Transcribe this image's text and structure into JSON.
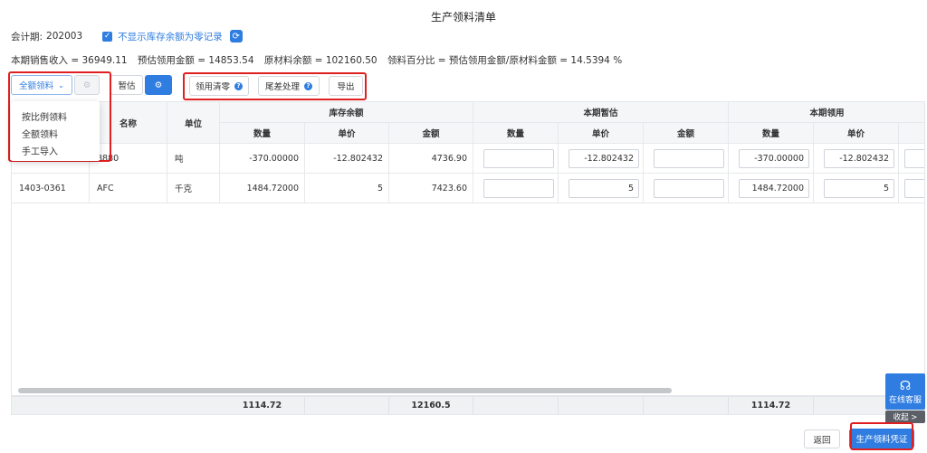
{
  "title": "生产领料清单",
  "period": {
    "label": "会计期:",
    "value": "202003"
  },
  "checkbox": {
    "label": "不显示库存余额为零记录",
    "checked": true
  },
  "summary": {
    "sales": "本期销售收入 = 36949.11",
    "estimate": "预估领用金额 = 14853.54",
    "material": "原材料余额 = 102160.50",
    "ratio": "领料百分比 = 预估领用金额/原材料金额 = 14.5394 %"
  },
  "toolbar": {
    "mode_select": "全额领料",
    "temp_estimate": "暂估",
    "clear": "领用清零",
    "tail": "尾差处理",
    "export": "导出"
  },
  "dropdown_options": [
    "按比例领料",
    "全额领料",
    "手工导入"
  ],
  "columns": {
    "name": "名称",
    "unit": "单位",
    "group_stock": "库存余额",
    "group_temp": "本期暂估",
    "group_use": "本期领用",
    "qty": "数量",
    "price": "单价",
    "amount": "金额"
  },
  "rows": [
    {
      "code": "",
      "name": "8880",
      "unit": "吨",
      "stock_qty": "-370.00000",
      "stock_price": "-12.802432",
      "stock_amount": "4736.90",
      "temp_qty": "",
      "temp_price": "-12.802432",
      "temp_amount": "",
      "use_qty": "-370.00000",
      "use_price": "-12.802432"
    },
    {
      "code": "1403-0361",
      "name": "AFC",
      "unit": "千克",
      "stock_qty": "1484.72000",
      "stock_price": "5",
      "stock_amount": "7423.60",
      "temp_qty": "",
      "temp_price": "5",
      "temp_amount": "",
      "use_qty": "1484.72000",
      "use_price": "5"
    }
  ],
  "totals": {
    "stock_qty": "1114.72",
    "stock_amount": "12160.5",
    "use_qty": "1114.72"
  },
  "footer": {
    "back": "返回",
    "voucher": "生产领料凭证"
  },
  "widgets": {
    "service": "在线客服",
    "fold": "收起 >"
  },
  "colors": {
    "primary": "#2f7de1",
    "highlight": "#e02020"
  }
}
